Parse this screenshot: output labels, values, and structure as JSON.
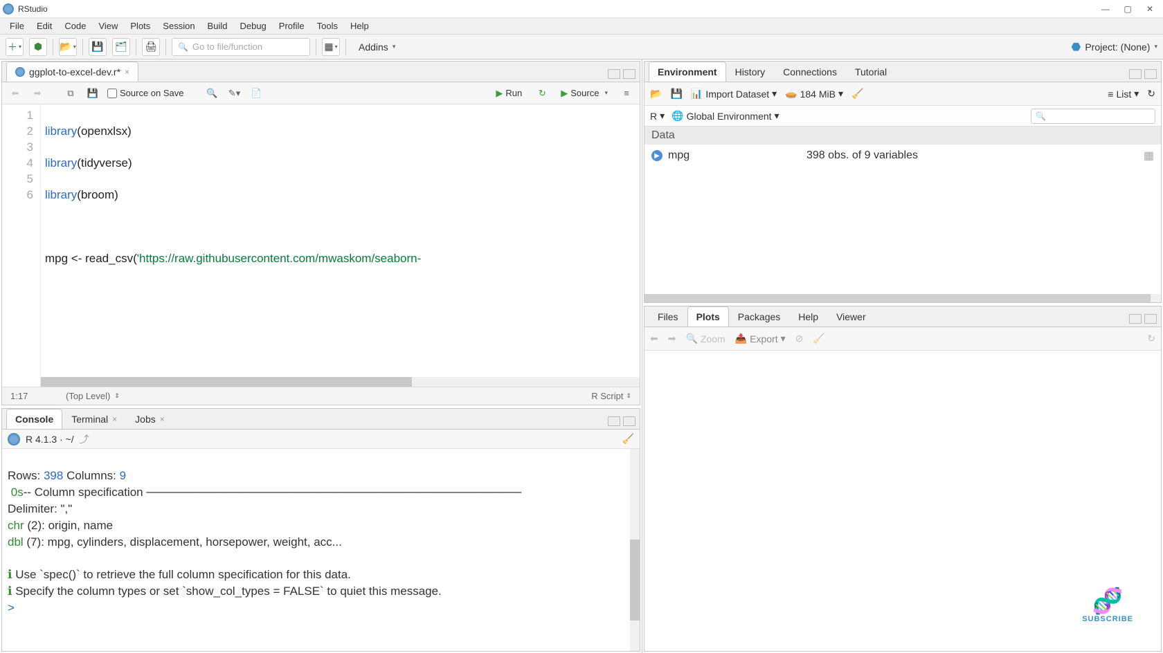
{
  "window": {
    "title": "RStudio"
  },
  "menu": {
    "items": [
      "File",
      "Edit",
      "Code",
      "View",
      "Plots",
      "Session",
      "Build",
      "Debug",
      "Profile",
      "Tools",
      "Help"
    ]
  },
  "maintb": {
    "goto_placeholder": "Go to file/function",
    "addins": "Addins",
    "project": "Project: (None)"
  },
  "source": {
    "tab": "ggplot-to-excel-dev.r*",
    "source_on_save": "Source on Save",
    "run": "Run",
    "source_btn": "Source",
    "cursor_pos": "1:17",
    "scope": "(Top Level)",
    "lang": "R Script",
    "lines": [
      {
        "n": "1",
        "pre": "library",
        "paren_open": "(",
        "arg": "openxlsx",
        "paren_close": ")"
      },
      {
        "n": "2",
        "pre": "library",
        "paren_open": "(",
        "arg": "tidyverse",
        "paren_close": ")"
      },
      {
        "n": "3",
        "pre": "library",
        "paren_open": "(",
        "arg": "broom",
        "paren_close": ")"
      },
      {
        "n": "4",
        "pre": "",
        "paren_open": "",
        "arg": "",
        "paren_close": ""
      },
      {
        "n": "5",
        "pre": "mpg <- read_csv",
        "paren_open": "(",
        "arg": "'https://raw.githubusercontent.com/mwaskom/seaborn-",
        "paren_close": ""
      },
      {
        "n": "6",
        "pre": "",
        "paren_open": "",
        "arg": "",
        "paren_close": ""
      }
    ]
  },
  "console": {
    "tabs": {
      "console": "Console",
      "terminal": "Terminal",
      "jobs": "Jobs"
    },
    "header": "R 4.1.3 · ~/",
    "out1_a": "Rows: ",
    "out1_b": "398",
    "out1_c": " Columns: ",
    "out1_d": "9",
    "out2_a": " 0s",
    "out2_b": "-- Column specification ─────────────────────────────────────────────",
    "out3": "Delimiter: \",\"",
    "out4_a": "chr",
    "out4_b": " (2): origin, name",
    "out5_a": "dbl",
    "out5_b": " (7): mpg, cylinders, displacement, horsepower, weight, acc...",
    "out6_a": "ℹ",
    "out6_b": " Use `spec()` to retrieve the full column specification for this data.",
    "out7_a": "ℹ",
    "out7_b": " Specify the column types or set `show_col_types = FALSE` to quiet this message.",
    "prompt": "> "
  },
  "env": {
    "tabs": {
      "environment": "Environment",
      "history": "History",
      "connections": "Connections",
      "tutorial": "Tutorial"
    },
    "import": "Import Dataset",
    "mem": "184 MiB",
    "list": "List",
    "lang": "R",
    "scope": "Global Environment",
    "section": "Data",
    "item_name": "mpg",
    "item_desc": "398 obs. of 9 variables"
  },
  "plots": {
    "tabs": {
      "files": "Files",
      "plots": "Plots",
      "packages": "Packages",
      "help": "Help",
      "viewer": "Viewer"
    },
    "zoom": "Zoom",
    "export": "Export"
  },
  "subscribe": "SUBSCRIBE"
}
